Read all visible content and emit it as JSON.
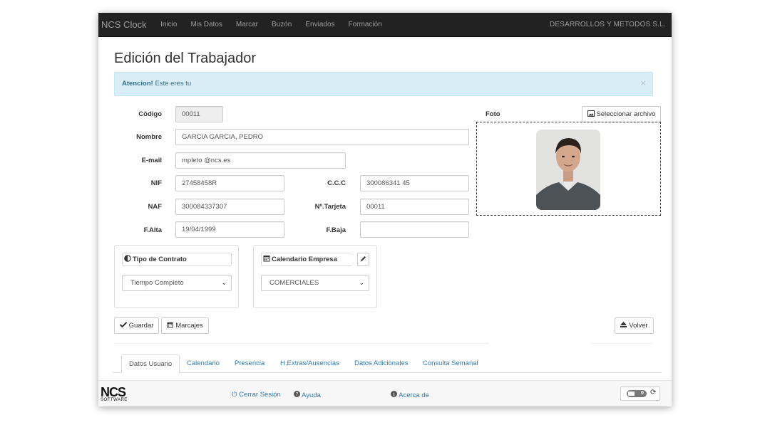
{
  "navbar": {
    "brand": "NCS Clock",
    "items": [
      "Inicio",
      "Mis Datos",
      "Marcar",
      "Buzón",
      "Enviados",
      "Formación"
    ],
    "company": "DESARROLLOS Y METODOS  S.L."
  },
  "page": {
    "title": "Edición del Trabajador"
  },
  "alert": {
    "strong": "Atencion!",
    "text": " Este eres tu",
    "close": "×"
  },
  "form": {
    "codigo": {
      "label": "Código",
      "value": "00011"
    },
    "nombre": {
      "label": "Nombre",
      "value": "GARCIA  GARCIA,  PEDRO"
    },
    "email": {
      "label": "E-mail",
      "value": "mpleto @ncs.es"
    },
    "nif": {
      "label": "NIF",
      "value": "27458458R"
    },
    "ccc": {
      "label": "C.C.C",
      "value": "300086341  45"
    },
    "naf": {
      "label": "NAF",
      "value": "300084337307"
    },
    "tarjeta": {
      "label": "Nº.Tarjeta",
      "value": "00011"
    },
    "falta": {
      "label": "F.Alta",
      "value": "19/04/1999"
    },
    "fbaja": {
      "label": "F.Baja",
      "value": ""
    }
  },
  "foto": {
    "label": "Foto",
    "select_button": "Seleccionar archivo"
  },
  "contrato": {
    "title": "Tipo de Contrato",
    "selected": "Tiempo Completo"
  },
  "calendario": {
    "title": "Calendario Empresa",
    "selected": "COMERCIALES"
  },
  "actions": {
    "guardar": "Guardar",
    "marcajes": "Marcajes",
    "volver": "Volver"
  },
  "tabs": [
    "Datos Usuario",
    "Calendario",
    "Presencia",
    "H.Extras/Ausencias",
    "Datos Adicionales",
    "Consulta Semanal"
  ],
  "footer": {
    "logo_big": "NCS",
    "logo_small": "SOFTWARE",
    "cerrar": "Cerrar Sesión",
    "ayuda": "Ayuda",
    "acerca": "Acerca de",
    "toggle_value": "0"
  },
  "colors": {
    "navbar": "#222222",
    "alert_bg": "#d9edf7",
    "link": "#337ab7"
  }
}
